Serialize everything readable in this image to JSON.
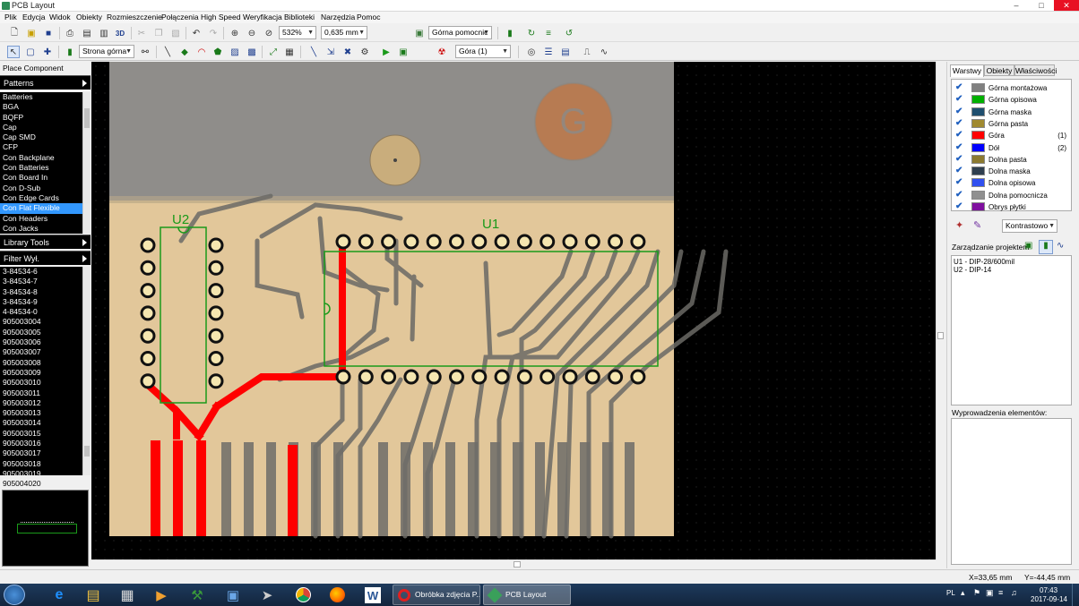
{
  "app": {
    "title": "PCB Layout"
  },
  "menu": [
    "Plik",
    "Edycja",
    "Widok",
    "Obiekty",
    "Rozmieszczenie",
    "Połączenia",
    "High Speed",
    "Weryfikacja",
    "Biblioteki",
    "Narzędzia",
    "Pomoc"
  ],
  "toolbar1": {
    "zoom": "532%",
    "grid": "0,635 mm",
    "view_label": "3D",
    "layer_select": "Górna pomocnic"
  },
  "toolbar2": {
    "side_select": "Strona górna",
    "layer_select": "Góra (1)"
  },
  "left": {
    "place_component": "Place Component",
    "patterns": "Patterns",
    "patterns_list": [
      "Batteries",
      "BGA",
      "BQFP",
      "Cap",
      "Cap SMD",
      "CFP",
      "Con Backplane",
      "Con Batteries",
      "Con Board In",
      "Con D-Sub",
      "Con Edge Cards",
      "Con Flat Flexible",
      "Con Headers",
      "Con Jacks"
    ],
    "patterns_selected": "Con Flat Flexible",
    "library_tools": "Library Tools",
    "filter": "Filter Wył.",
    "parts_list": [
      "3-84534-6",
      "3-84534-7",
      "3-84534-8",
      "3-84534-9",
      "4-84534-0",
      "905003004",
      "905003005",
      "905003006",
      "905003007",
      "905003008",
      "905003009",
      "905003010",
      "905003011",
      "905003012",
      "905003013",
      "905003014",
      "905003015",
      "905003016",
      "905003017",
      "905003018",
      "905003019"
    ],
    "selected_part": "905004020"
  },
  "canvas": {
    "u1_label": "U1",
    "u2_label": "U2",
    "board_letter": "G"
  },
  "right": {
    "tabs": [
      "Warstwy",
      "Obiekty",
      "Właściwości"
    ],
    "layers": [
      {
        "name": "Górna montażowa",
        "color": "#808080",
        "index": ""
      },
      {
        "name": "Górna opisowa",
        "color": "#00b000",
        "index": ""
      },
      {
        "name": "Górna maska",
        "color": "#1f4f6f",
        "index": ""
      },
      {
        "name": "Górna pasta",
        "color": "#a08a30",
        "index": ""
      },
      {
        "name": "Góra",
        "color": "#ff0000",
        "index": "(1)"
      },
      {
        "name": "Dół",
        "color": "#0000ff",
        "index": "(2)"
      },
      {
        "name": "Dolna pasta",
        "color": "#8c7a30",
        "index": ""
      },
      {
        "name": "Dolna maska",
        "color": "#2f3f4f",
        "index": ""
      },
      {
        "name": "Dolna opisowa",
        "color": "#3050f0",
        "index": ""
      },
      {
        "name": "Dolna pomocnicza",
        "color": "#909090",
        "index": ""
      },
      {
        "name": "Obrys płytki",
        "color": "#8010a0",
        "index": ""
      }
    ],
    "contrast": "Kontrastowo",
    "project_title": "Zarządzanie projektem",
    "project_items": [
      "U1 - DIP-28/600mil",
      "U2 - DIP-14"
    ],
    "pins_title": "Wyprowadzenia elementów:"
  },
  "status": {
    "x": "X=33,65 mm",
    "y": "Y=-44,45 mm"
  },
  "taskbar": {
    "win1": "Obróbka zdjęcia P...",
    "win2": "PCB Layout",
    "lang": "PL",
    "time": "07:43",
    "date": "2017-09-14"
  }
}
